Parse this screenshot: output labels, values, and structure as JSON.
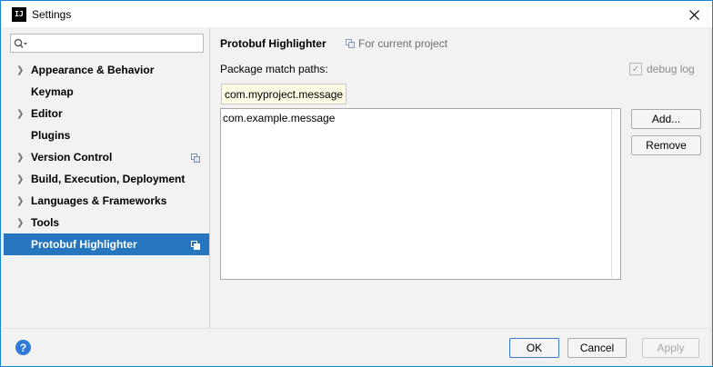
{
  "window": {
    "title": "Settings",
    "app_icon_text": "IJ"
  },
  "search": {
    "placeholder": "",
    "value": ""
  },
  "sidebar": {
    "items": [
      {
        "label": "Appearance & Behavior",
        "expandable": true,
        "project_scope": false
      },
      {
        "label": "Keymap",
        "expandable": false,
        "project_scope": false
      },
      {
        "label": "Editor",
        "expandable": true,
        "project_scope": false
      },
      {
        "label": "Plugins",
        "expandable": false,
        "project_scope": false
      },
      {
        "label": "Version Control",
        "expandable": true,
        "project_scope": true
      },
      {
        "label": "Build, Execution, Deployment",
        "expandable": true,
        "project_scope": false
      },
      {
        "label": "Languages & Frameworks",
        "expandable": true,
        "project_scope": false
      },
      {
        "label": "Tools",
        "expandable": true,
        "project_scope": false
      },
      {
        "label": "Protobuf Highlighter",
        "expandable": false,
        "project_scope": true,
        "selected": true
      }
    ]
  },
  "content": {
    "heading": "Protobuf Highlighter",
    "scope_label": "For current project",
    "package_label": "Package match paths:",
    "debug_log_label": "debug log",
    "debug_log_checked": true,
    "package_input_value": "com.myproject.message",
    "list_items": [
      "com.example.message"
    ],
    "add_label": "Add...",
    "remove_label": "Remove"
  },
  "footer": {
    "help_label": "?",
    "ok_label": "OK",
    "cancel_label": "Cancel",
    "apply_label": "Apply"
  },
  "colors": {
    "accent": "#2675bf",
    "window_border": "#1883d7",
    "input_highlight": "#fdfbe3"
  }
}
